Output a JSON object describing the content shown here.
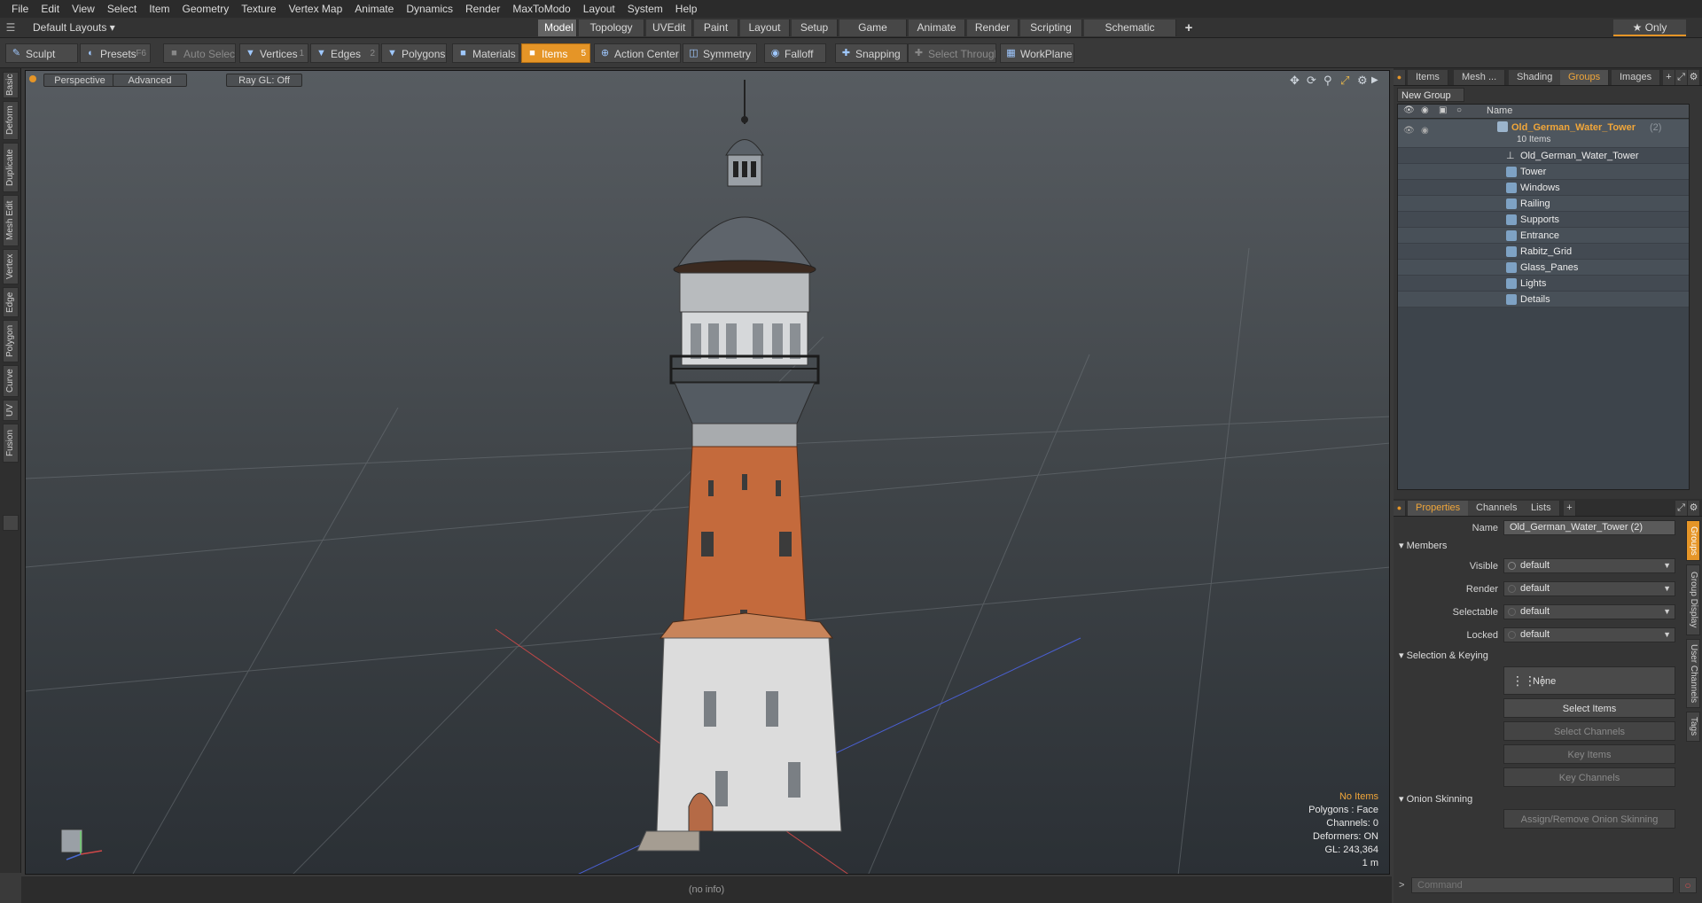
{
  "menu": [
    "File",
    "Edit",
    "View",
    "Select",
    "Item",
    "Geometry",
    "Texture",
    "Vertex Map",
    "Animate",
    "Dynamics",
    "Render",
    "MaxToModo",
    "Layout",
    "System",
    "Help"
  ],
  "layout_selector": "Default Layouts ▾",
  "layout_tabs": [
    "Model",
    "Topology",
    "UVEdit",
    "Paint",
    "Layout",
    "Setup",
    "Game Tools",
    "Animate",
    "Render",
    "Scripting",
    "Schematic Fusion"
  ],
  "add_tab": "+",
  "only_label": "★ Only",
  "toolbar": {
    "sculpt": "Sculpt",
    "presets": "Presets",
    "presets_key": "F6",
    "auto_select": "Auto Select",
    "vertices": "Vertices",
    "vertices_key": "1",
    "edges": "Edges",
    "edges_key": "2",
    "polygons": "Polygons",
    "materials": "Materials",
    "items": "Items",
    "items_key": "5",
    "action_center": "Action Center",
    "symmetry": "Symmetry",
    "falloff": "Falloff",
    "snapping": "Snapping",
    "select_through": "Select Through",
    "workplane": "WorkPlane"
  },
  "left_tabs": [
    "Basic",
    "Deform",
    "Duplicate",
    "Mesh Edit",
    "Vertex",
    "Edge",
    "Polygon",
    "Curve",
    "UV",
    "Fusion"
  ],
  "viewport": {
    "view": "Perspective",
    "shading": "Advanced",
    "raygl": "Ray GL: Off",
    "info": {
      "items": "No Items",
      "polygons": "Polygons : Face",
      "channels": "Channels: 0",
      "deformers": "Deformers: ON",
      "gl": "GL: 243,364",
      "scale": "1 m"
    }
  },
  "status": "(no info)",
  "top_panel_tabs": [
    "Items",
    "Mesh ...",
    "Shading",
    "Groups",
    "Images"
  ],
  "groups": {
    "new_group": "New Group",
    "name_header": "Name",
    "root_name": "Old_German_Water_Tower",
    "root_count": "(2)",
    "root_items": "10 Items",
    "children": [
      "Old_German_Water_Tower",
      "Tower",
      "Windows",
      "Railing",
      "Supports",
      "Entrance",
      "Rabitz_Grid",
      "Glass_Panes",
      "Lights",
      "Details"
    ]
  },
  "bottom_panel_tabs": [
    "Properties",
    "Channels",
    "Lists"
  ],
  "properties": {
    "name_label": "Name",
    "name_value": "Old_German_Water_Tower (2)",
    "members_label": "Members",
    "visible_label": "Visible",
    "visible_value": "default",
    "render_label": "Render",
    "render_value": "default",
    "selectable_label": "Selectable",
    "selectable_value": "default",
    "locked_label": "Locked",
    "locked_value": "default",
    "selection_keying": "Selection & Keying",
    "none_label": "None",
    "select_items": "Select Items",
    "select_channels": "Select Channels",
    "key_items": "Key Items",
    "key_channels": "Key Channels",
    "onion_skinning": "Onion Skinning",
    "assign_onion": "Assign/Remove Onion Skinning"
  },
  "side_tabs": [
    "Groups",
    "Group Display",
    "User Channels",
    "Tags"
  ],
  "command_placeholder": "Command",
  "command_prompt": ">"
}
